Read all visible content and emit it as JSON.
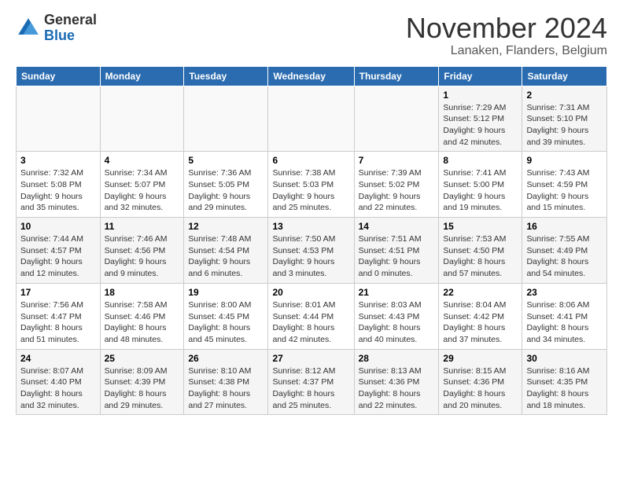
{
  "logo": {
    "general": "General",
    "blue": "Blue"
  },
  "title": "November 2024",
  "location": "Lanaken, Flanders, Belgium",
  "days_of_week": [
    "Sunday",
    "Monday",
    "Tuesday",
    "Wednesday",
    "Thursday",
    "Friday",
    "Saturday"
  ],
  "weeks": [
    [
      {
        "day": "",
        "info": ""
      },
      {
        "day": "",
        "info": ""
      },
      {
        "day": "",
        "info": ""
      },
      {
        "day": "",
        "info": ""
      },
      {
        "day": "",
        "info": ""
      },
      {
        "day": "1",
        "info": "Sunrise: 7:29 AM\nSunset: 5:12 PM\nDaylight: 9 hours and 42 minutes."
      },
      {
        "day": "2",
        "info": "Sunrise: 7:31 AM\nSunset: 5:10 PM\nDaylight: 9 hours and 39 minutes."
      }
    ],
    [
      {
        "day": "3",
        "info": "Sunrise: 7:32 AM\nSunset: 5:08 PM\nDaylight: 9 hours and 35 minutes."
      },
      {
        "day": "4",
        "info": "Sunrise: 7:34 AM\nSunset: 5:07 PM\nDaylight: 9 hours and 32 minutes."
      },
      {
        "day": "5",
        "info": "Sunrise: 7:36 AM\nSunset: 5:05 PM\nDaylight: 9 hours and 29 minutes."
      },
      {
        "day": "6",
        "info": "Sunrise: 7:38 AM\nSunset: 5:03 PM\nDaylight: 9 hours and 25 minutes."
      },
      {
        "day": "7",
        "info": "Sunrise: 7:39 AM\nSunset: 5:02 PM\nDaylight: 9 hours and 22 minutes."
      },
      {
        "day": "8",
        "info": "Sunrise: 7:41 AM\nSunset: 5:00 PM\nDaylight: 9 hours and 19 minutes."
      },
      {
        "day": "9",
        "info": "Sunrise: 7:43 AM\nSunset: 4:59 PM\nDaylight: 9 hours and 15 minutes."
      }
    ],
    [
      {
        "day": "10",
        "info": "Sunrise: 7:44 AM\nSunset: 4:57 PM\nDaylight: 9 hours and 12 minutes."
      },
      {
        "day": "11",
        "info": "Sunrise: 7:46 AM\nSunset: 4:56 PM\nDaylight: 9 hours and 9 minutes."
      },
      {
        "day": "12",
        "info": "Sunrise: 7:48 AM\nSunset: 4:54 PM\nDaylight: 9 hours and 6 minutes."
      },
      {
        "day": "13",
        "info": "Sunrise: 7:50 AM\nSunset: 4:53 PM\nDaylight: 9 hours and 3 minutes."
      },
      {
        "day": "14",
        "info": "Sunrise: 7:51 AM\nSunset: 4:51 PM\nDaylight: 9 hours and 0 minutes."
      },
      {
        "day": "15",
        "info": "Sunrise: 7:53 AM\nSunset: 4:50 PM\nDaylight: 8 hours and 57 minutes."
      },
      {
        "day": "16",
        "info": "Sunrise: 7:55 AM\nSunset: 4:49 PM\nDaylight: 8 hours and 54 minutes."
      }
    ],
    [
      {
        "day": "17",
        "info": "Sunrise: 7:56 AM\nSunset: 4:47 PM\nDaylight: 8 hours and 51 minutes."
      },
      {
        "day": "18",
        "info": "Sunrise: 7:58 AM\nSunset: 4:46 PM\nDaylight: 8 hours and 48 minutes."
      },
      {
        "day": "19",
        "info": "Sunrise: 8:00 AM\nSunset: 4:45 PM\nDaylight: 8 hours and 45 minutes."
      },
      {
        "day": "20",
        "info": "Sunrise: 8:01 AM\nSunset: 4:44 PM\nDaylight: 8 hours and 42 minutes."
      },
      {
        "day": "21",
        "info": "Sunrise: 8:03 AM\nSunset: 4:43 PM\nDaylight: 8 hours and 40 minutes."
      },
      {
        "day": "22",
        "info": "Sunrise: 8:04 AM\nSunset: 4:42 PM\nDaylight: 8 hours and 37 minutes."
      },
      {
        "day": "23",
        "info": "Sunrise: 8:06 AM\nSunset: 4:41 PM\nDaylight: 8 hours and 34 minutes."
      }
    ],
    [
      {
        "day": "24",
        "info": "Sunrise: 8:07 AM\nSunset: 4:40 PM\nDaylight: 8 hours and 32 minutes."
      },
      {
        "day": "25",
        "info": "Sunrise: 8:09 AM\nSunset: 4:39 PM\nDaylight: 8 hours and 29 minutes."
      },
      {
        "day": "26",
        "info": "Sunrise: 8:10 AM\nSunset: 4:38 PM\nDaylight: 8 hours and 27 minutes."
      },
      {
        "day": "27",
        "info": "Sunrise: 8:12 AM\nSunset: 4:37 PM\nDaylight: 8 hours and 25 minutes."
      },
      {
        "day": "28",
        "info": "Sunrise: 8:13 AM\nSunset: 4:36 PM\nDaylight: 8 hours and 22 minutes."
      },
      {
        "day": "29",
        "info": "Sunrise: 8:15 AM\nSunset: 4:36 PM\nDaylight: 8 hours and 20 minutes."
      },
      {
        "day": "30",
        "info": "Sunrise: 8:16 AM\nSunset: 4:35 PM\nDaylight: 8 hours and 18 minutes."
      }
    ]
  ]
}
